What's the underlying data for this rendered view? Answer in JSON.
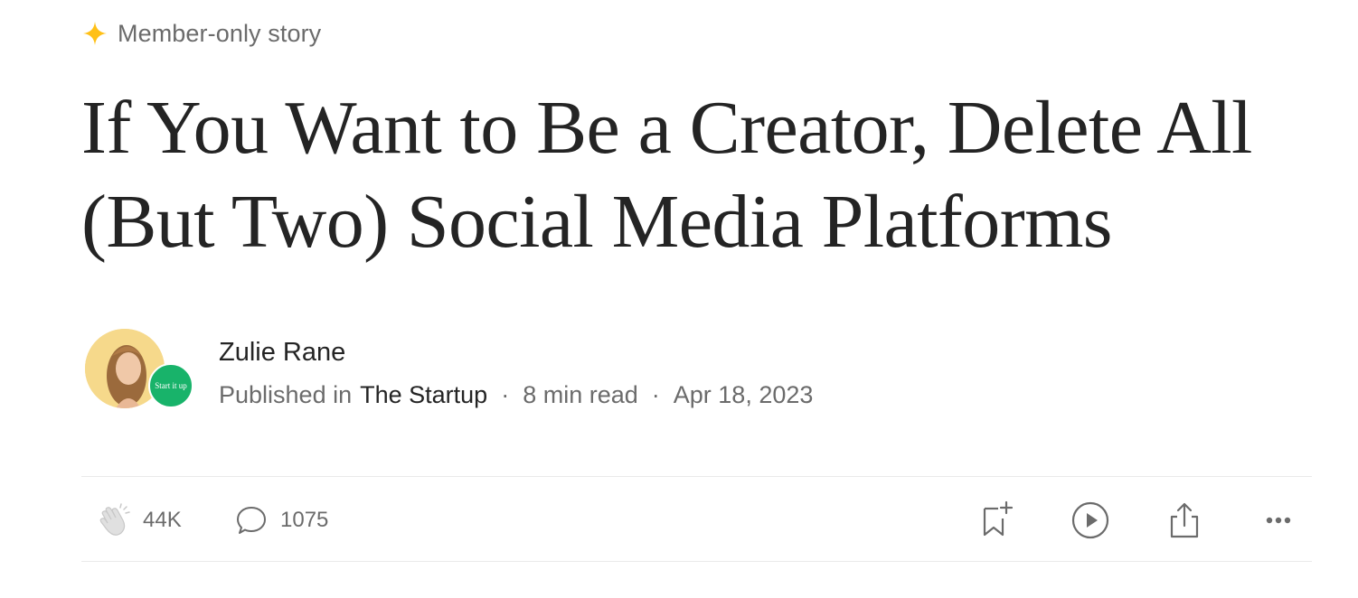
{
  "member_badge": {
    "label": "Member-only story",
    "icon": "sparkle-icon",
    "color": "#ffc017"
  },
  "article": {
    "title": "If You Want to Be a Creator, Delete All (But Two) Social Media Platforms"
  },
  "author": {
    "name": "Zulie Rane",
    "publication_badge_text": "Start it up",
    "published_in_label": "Published in",
    "publication": "The Startup",
    "read_time": "8 min read",
    "date": "Apr 18, 2023",
    "separator": "·"
  },
  "actions": {
    "claps": "44K",
    "responses": "1075",
    "icons": [
      "clap-icon",
      "response-icon",
      "bookmark-add-icon",
      "play-icon",
      "share-icon",
      "more-icon"
    ]
  },
  "colors": {
    "publication_green": "#18b36a",
    "text": "#242424",
    "muted": "#6b6b6b"
  }
}
